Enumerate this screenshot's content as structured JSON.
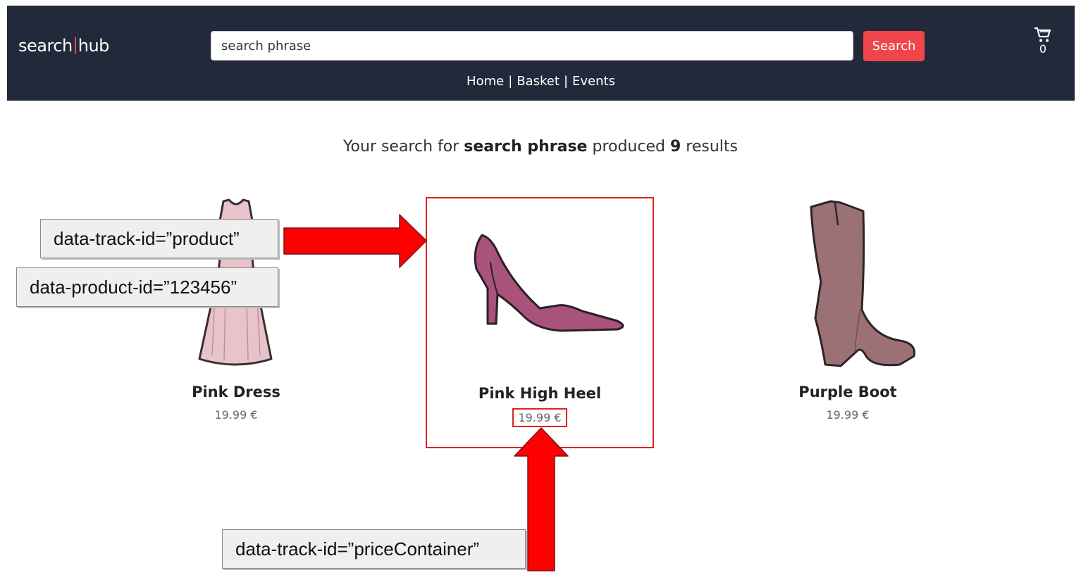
{
  "header": {
    "logo_left": "search",
    "logo_right": "hub",
    "search_value": "search phrase",
    "search_button": "Search",
    "cart_count": "0",
    "nav": [
      "Home",
      "Basket",
      "Events"
    ],
    "nav_separator": "|"
  },
  "summary": {
    "prefix": "Your search for",
    "phrase": "search phrase",
    "middle": "produced",
    "count": "9",
    "suffix": "results"
  },
  "products": [
    {
      "name": "Pink Dress",
      "price": "19.99 €",
      "color": "#e8c3c9"
    },
    {
      "name": "Pink High Heel",
      "price": "19.99 €",
      "color": "#a8527c"
    },
    {
      "name": "Purple Boot",
      "price": "19.99 €",
      "color": "#9c7176"
    }
  ],
  "annotations": {
    "track_id_product": "data-track-id=”product”",
    "product_id": "data-product-id=”123456”",
    "track_id_price": "data-track-id=”priceContainer”"
  },
  "colors": {
    "header_bg": "#22293a",
    "accent": "#f0454a",
    "annotation_red": "#ff0000"
  }
}
